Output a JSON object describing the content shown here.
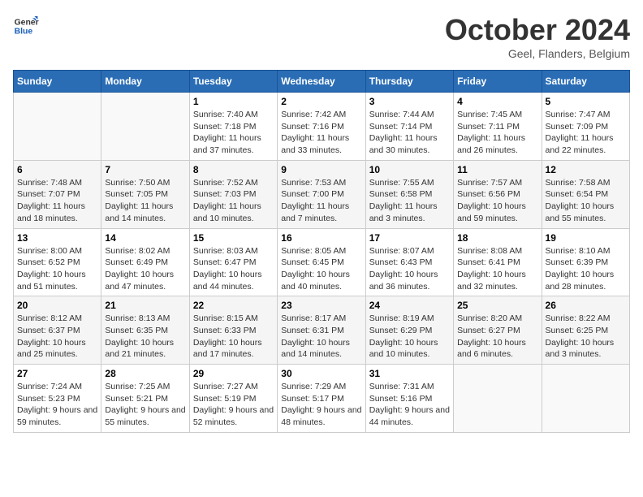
{
  "header": {
    "logo_line1": "General",
    "logo_line2": "Blue",
    "title": "October 2024",
    "location": "Geel, Flanders, Belgium"
  },
  "days_of_week": [
    "Sunday",
    "Monday",
    "Tuesday",
    "Wednesday",
    "Thursday",
    "Friday",
    "Saturday"
  ],
  "weeks": [
    [
      {
        "num": "",
        "info": ""
      },
      {
        "num": "",
        "info": ""
      },
      {
        "num": "1",
        "info": "Sunrise: 7:40 AM\nSunset: 7:18 PM\nDaylight: 11 hours and 37 minutes."
      },
      {
        "num": "2",
        "info": "Sunrise: 7:42 AM\nSunset: 7:16 PM\nDaylight: 11 hours and 33 minutes."
      },
      {
        "num": "3",
        "info": "Sunrise: 7:44 AM\nSunset: 7:14 PM\nDaylight: 11 hours and 30 minutes."
      },
      {
        "num": "4",
        "info": "Sunrise: 7:45 AM\nSunset: 7:11 PM\nDaylight: 11 hours and 26 minutes."
      },
      {
        "num": "5",
        "info": "Sunrise: 7:47 AM\nSunset: 7:09 PM\nDaylight: 11 hours and 22 minutes."
      }
    ],
    [
      {
        "num": "6",
        "info": "Sunrise: 7:48 AM\nSunset: 7:07 PM\nDaylight: 11 hours and 18 minutes."
      },
      {
        "num": "7",
        "info": "Sunrise: 7:50 AM\nSunset: 7:05 PM\nDaylight: 11 hours and 14 minutes."
      },
      {
        "num": "8",
        "info": "Sunrise: 7:52 AM\nSunset: 7:03 PM\nDaylight: 11 hours and 10 minutes."
      },
      {
        "num": "9",
        "info": "Sunrise: 7:53 AM\nSunset: 7:00 PM\nDaylight: 11 hours and 7 minutes."
      },
      {
        "num": "10",
        "info": "Sunrise: 7:55 AM\nSunset: 6:58 PM\nDaylight: 11 hours and 3 minutes."
      },
      {
        "num": "11",
        "info": "Sunrise: 7:57 AM\nSunset: 6:56 PM\nDaylight: 10 hours and 59 minutes."
      },
      {
        "num": "12",
        "info": "Sunrise: 7:58 AM\nSunset: 6:54 PM\nDaylight: 10 hours and 55 minutes."
      }
    ],
    [
      {
        "num": "13",
        "info": "Sunrise: 8:00 AM\nSunset: 6:52 PM\nDaylight: 10 hours and 51 minutes."
      },
      {
        "num": "14",
        "info": "Sunrise: 8:02 AM\nSunset: 6:49 PM\nDaylight: 10 hours and 47 minutes."
      },
      {
        "num": "15",
        "info": "Sunrise: 8:03 AM\nSunset: 6:47 PM\nDaylight: 10 hours and 44 minutes."
      },
      {
        "num": "16",
        "info": "Sunrise: 8:05 AM\nSunset: 6:45 PM\nDaylight: 10 hours and 40 minutes."
      },
      {
        "num": "17",
        "info": "Sunrise: 8:07 AM\nSunset: 6:43 PM\nDaylight: 10 hours and 36 minutes."
      },
      {
        "num": "18",
        "info": "Sunrise: 8:08 AM\nSunset: 6:41 PM\nDaylight: 10 hours and 32 minutes."
      },
      {
        "num": "19",
        "info": "Sunrise: 8:10 AM\nSunset: 6:39 PM\nDaylight: 10 hours and 28 minutes."
      }
    ],
    [
      {
        "num": "20",
        "info": "Sunrise: 8:12 AM\nSunset: 6:37 PM\nDaylight: 10 hours and 25 minutes."
      },
      {
        "num": "21",
        "info": "Sunrise: 8:13 AM\nSunset: 6:35 PM\nDaylight: 10 hours and 21 minutes."
      },
      {
        "num": "22",
        "info": "Sunrise: 8:15 AM\nSunset: 6:33 PM\nDaylight: 10 hours and 17 minutes."
      },
      {
        "num": "23",
        "info": "Sunrise: 8:17 AM\nSunset: 6:31 PM\nDaylight: 10 hours and 14 minutes."
      },
      {
        "num": "24",
        "info": "Sunrise: 8:19 AM\nSunset: 6:29 PM\nDaylight: 10 hours and 10 minutes."
      },
      {
        "num": "25",
        "info": "Sunrise: 8:20 AM\nSunset: 6:27 PM\nDaylight: 10 hours and 6 minutes."
      },
      {
        "num": "26",
        "info": "Sunrise: 8:22 AM\nSunset: 6:25 PM\nDaylight: 10 hours and 3 minutes."
      }
    ],
    [
      {
        "num": "27",
        "info": "Sunrise: 7:24 AM\nSunset: 5:23 PM\nDaylight: 9 hours and 59 minutes."
      },
      {
        "num": "28",
        "info": "Sunrise: 7:25 AM\nSunset: 5:21 PM\nDaylight: 9 hours and 55 minutes."
      },
      {
        "num": "29",
        "info": "Sunrise: 7:27 AM\nSunset: 5:19 PM\nDaylight: 9 hours and 52 minutes."
      },
      {
        "num": "30",
        "info": "Sunrise: 7:29 AM\nSunset: 5:17 PM\nDaylight: 9 hours and 48 minutes."
      },
      {
        "num": "31",
        "info": "Sunrise: 7:31 AM\nSunset: 5:16 PM\nDaylight: 9 hours and 44 minutes."
      },
      {
        "num": "",
        "info": ""
      },
      {
        "num": "",
        "info": ""
      }
    ]
  ]
}
